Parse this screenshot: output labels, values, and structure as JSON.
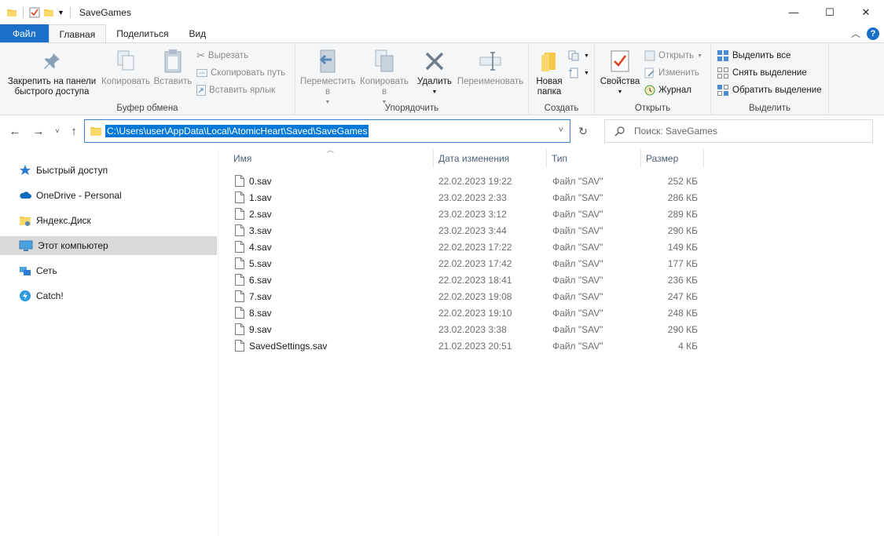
{
  "window": {
    "title": "SaveGames",
    "minimize": "—",
    "maximize": "☐",
    "close": "✕"
  },
  "tabs": {
    "file": "Файл",
    "home": "Главная",
    "share": "Поделиться",
    "view": "Вид"
  },
  "ribbon": {
    "clipboard": {
      "label": "Буфер обмена",
      "pin": "Закрепить на панели быстрого доступа",
      "copy": "Копировать",
      "paste": "Вставить",
      "cut": "Вырезать",
      "copy_path": "Скопировать путь",
      "paste_shortcut": "Вставить ярлык"
    },
    "organize": {
      "label": "Упорядочить",
      "move_to": "Переместить в",
      "copy_to": "Копировать в",
      "delete": "Удалить",
      "rename": "Переименовать"
    },
    "new": {
      "label": "Создать",
      "new_folder": "Новая папка"
    },
    "open": {
      "label": "Открыть",
      "properties": "Свойства",
      "open": "Открыть",
      "edit": "Изменить",
      "history": "Журнал"
    },
    "select": {
      "label": "Выделить",
      "select_all": "Выделить все",
      "select_none": "Снять выделение",
      "invert": "Обратить выделение"
    }
  },
  "address": {
    "path": "C:\\Users\\user\\AppData\\Local\\AtomicHeart\\Saved\\SaveGames",
    "search_placeholder": "Поиск: SaveGames"
  },
  "sidebar": {
    "items": [
      {
        "label": "Быстрый доступ",
        "icon": "star-icon"
      },
      {
        "label": "OneDrive - Personal",
        "icon": "cloud-icon"
      },
      {
        "label": "Яндекс.Диск",
        "icon": "folder-icon"
      },
      {
        "label": "Этот компьютер",
        "icon": "computer-icon"
      },
      {
        "label": "Сеть",
        "icon": "network-icon"
      },
      {
        "label": "Catch!",
        "icon": "catch-icon"
      }
    ]
  },
  "columns": {
    "name": "Имя",
    "date": "Дата изменения",
    "type": "Тип",
    "size": "Размер"
  },
  "files": [
    {
      "name": "0.sav",
      "date": "22.02.2023 19:22",
      "type": "Файл \"SAV\"",
      "size": "252 КБ"
    },
    {
      "name": "1.sav",
      "date": "23.02.2023 2:33",
      "type": "Файл \"SAV\"",
      "size": "286 КБ"
    },
    {
      "name": "2.sav",
      "date": "23.02.2023 3:12",
      "type": "Файл \"SAV\"",
      "size": "289 КБ"
    },
    {
      "name": "3.sav",
      "date": "23.02.2023 3:44",
      "type": "Файл \"SAV\"",
      "size": "290 КБ"
    },
    {
      "name": "4.sav",
      "date": "22.02.2023 17:22",
      "type": "Файл \"SAV\"",
      "size": "149 КБ"
    },
    {
      "name": "5.sav",
      "date": "22.02.2023 17:42",
      "type": "Файл \"SAV\"",
      "size": "177 КБ"
    },
    {
      "name": "6.sav",
      "date": "22.02.2023 18:41",
      "type": "Файл \"SAV\"",
      "size": "236 КБ"
    },
    {
      "name": "7.sav",
      "date": "22.02.2023 19:08",
      "type": "Файл \"SAV\"",
      "size": "247 КБ"
    },
    {
      "name": "8.sav",
      "date": "22.02.2023 19:10",
      "type": "Файл \"SAV\"",
      "size": "248 КБ"
    },
    {
      "name": "9.sav",
      "date": "23.02.2023 3:38",
      "type": "Файл \"SAV\"",
      "size": "290 КБ"
    },
    {
      "name": "SavedSettings.sav",
      "date": "21.02.2023 20:51",
      "type": "Файл \"SAV\"",
      "size": "4 КБ"
    }
  ]
}
